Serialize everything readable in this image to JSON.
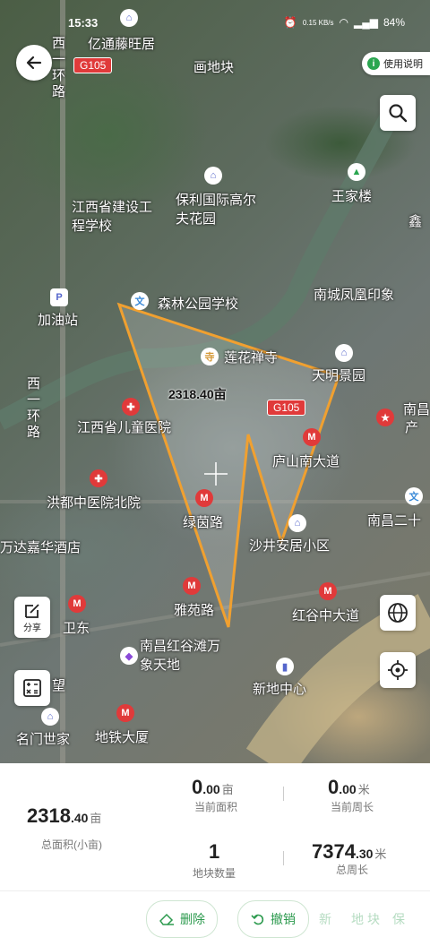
{
  "status": {
    "time": "15:33",
    "net_speed": "0.15 KB/s",
    "battery": "84%"
  },
  "header": {
    "help_label": "使用说明"
  },
  "map": {
    "roads": [
      "G105",
      "G105"
    ],
    "labels": [
      "画地块",
      "亿通藤旺居",
      "西一环路",
      "江西省建设工程学校",
      "保利国际高尔夫花园",
      "王家楼",
      "鑫",
      "加油站",
      "森林公园学校",
      "南城凤凰印象",
      "莲花禅寺",
      "天明景园",
      "南昌",
      "产",
      "江西省儿童医院",
      "西一环路",
      "庐山南大道",
      "洪都中医院北院",
      "绿茵路",
      "南昌二十",
      "万达嘉华酒店",
      "沙井安居小区",
      "雅苑路",
      "红谷中大道",
      "卫东",
      "南昌红谷滩万象天地",
      "新地中心",
      "名门世家",
      "地铁大厦",
      "望"
    ],
    "area_label": "2318.40亩"
  },
  "tools": {
    "share_label": "分享"
  },
  "stats": {
    "total_area": {
      "int": "2318",
      "dec": ".40",
      "unit": "亩",
      "label": "总面积(小亩)"
    },
    "current_area": {
      "int": "0",
      "dec": ".00",
      "unit": "亩",
      "label": "当前面积"
    },
    "current_perimeter": {
      "int": "0",
      "dec": ".00",
      "unit": "米",
      "label": "当前周长"
    },
    "plot_count": {
      "value": "1",
      "label": "地块数量"
    },
    "total_perimeter": {
      "int": "7374",
      "dec": ".30",
      "unit": "米",
      "label": "总周长"
    }
  },
  "actions": {
    "delete_label": "删除",
    "undo_label": "撤销",
    "faded": [
      "新",
      "地",
      "块",
      "保"
    ]
  },
  "colors": {
    "accent": "#2c9a4e",
    "polygon": "#f0a030",
    "road_badge": "#e03a3a"
  }
}
